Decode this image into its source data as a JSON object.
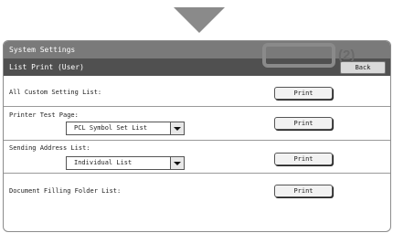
{
  "header": {
    "title": "System Settings"
  },
  "subheader": {
    "title": "List Print (User)",
    "back_label": "Back"
  },
  "rows": [
    {
      "label": "All Custom Setting List:",
      "button": "Print"
    },
    {
      "label": "Printer Test Page:",
      "select": "PCL Symbol Set List",
      "button": "Print"
    },
    {
      "label": "Sending Address List:",
      "select": "Individual List",
      "button": "Print"
    },
    {
      "label": "Document Filling Folder List:",
      "button": "Print"
    }
  ],
  "callout": {
    "label": "(2)"
  }
}
